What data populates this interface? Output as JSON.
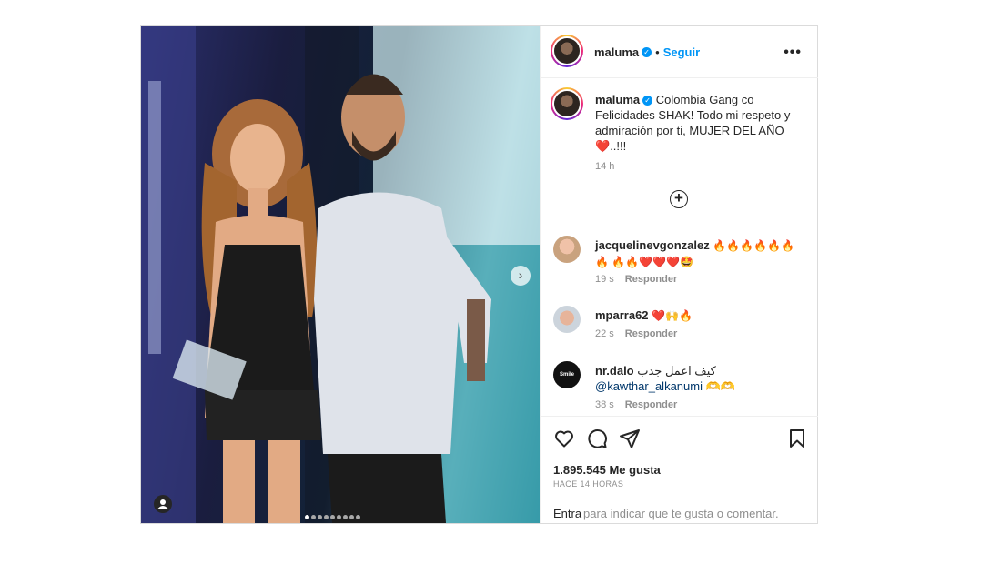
{
  "post": {
    "username": "maluma",
    "follow_label": "Seguir",
    "separator": "•",
    "more_label": "•••",
    "caption_text": "Colombia Gang co Felicidades SHAK! Todo mi respeto y admiración por ti, MUJER DEL AÑO",
    "caption_end": "..!!!",
    "caption_time": "14 h",
    "likes": "1.895.545 Me gusta",
    "posted_ago": "HACE 14 HORAS",
    "login_label": "Entra",
    "comment_prompt": "para indicar que te gusta o comentar.",
    "carousel": {
      "current": 1,
      "total": 9
    }
  },
  "comments": [
    {
      "username": "jacquelinevgonzalez",
      "text": "",
      "time": "19 s",
      "reply": "Responder"
    },
    {
      "username": "mparra62",
      "text": "",
      "time": "22 s",
      "reply": "Responder"
    },
    {
      "username": "nr.dalo",
      "text": "كيف اعمل جذب",
      "mention": "@kawthar_alkanumi",
      "mention_suffix": "🫶🫶",
      "time": "38 s",
      "reply": "Responder",
      "avatar_text": "Smile"
    }
  ],
  "colors": {
    "accent": "#0095f6",
    "muted": "#8e8e8e",
    "heart": "#ed4956"
  },
  "icons": [
    "heart-icon",
    "comment-icon",
    "share-icon",
    "bookmark-icon",
    "more-icon",
    "add-circle-icon",
    "verified-icon",
    "chevron-right-icon",
    "person-tag-icon"
  ]
}
